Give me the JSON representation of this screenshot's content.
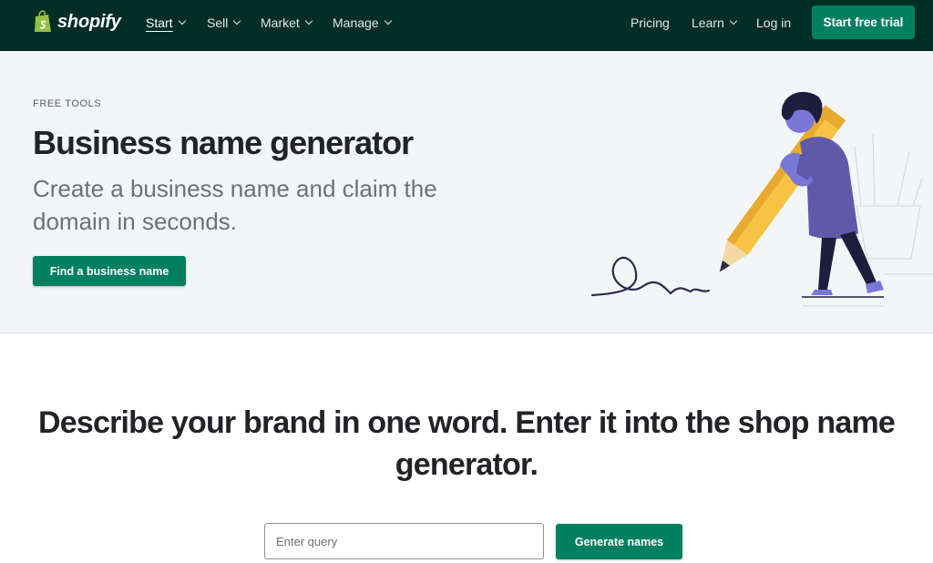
{
  "nav": {
    "logo_text": "shopify",
    "items": [
      {
        "label": "Start",
        "active": true
      },
      {
        "label": "Sell"
      },
      {
        "label": "Market"
      },
      {
        "label": "Manage"
      }
    ],
    "pricing": "Pricing",
    "learn": "Learn",
    "login": "Log in",
    "cta": "Start free trial"
  },
  "hero": {
    "eyebrow": "FREE TOOLS",
    "title": "Business name generator",
    "subtitle": "Create a business name and claim the domain in seconds.",
    "button": "Find a business name"
  },
  "generator": {
    "heading": "Describe your brand in one word. Enter it into the shop name generator.",
    "placeholder": "Enter query",
    "button": "Generate names"
  },
  "colors": {
    "nav_bg": "#002e25",
    "accent": "#008060",
    "hero_bg": "#f4f5f7"
  },
  "icons": {
    "logo": "shopify-bag-icon",
    "dropdown": "chevron-down-icon",
    "illustration": "person-with-pencil-illustration"
  }
}
